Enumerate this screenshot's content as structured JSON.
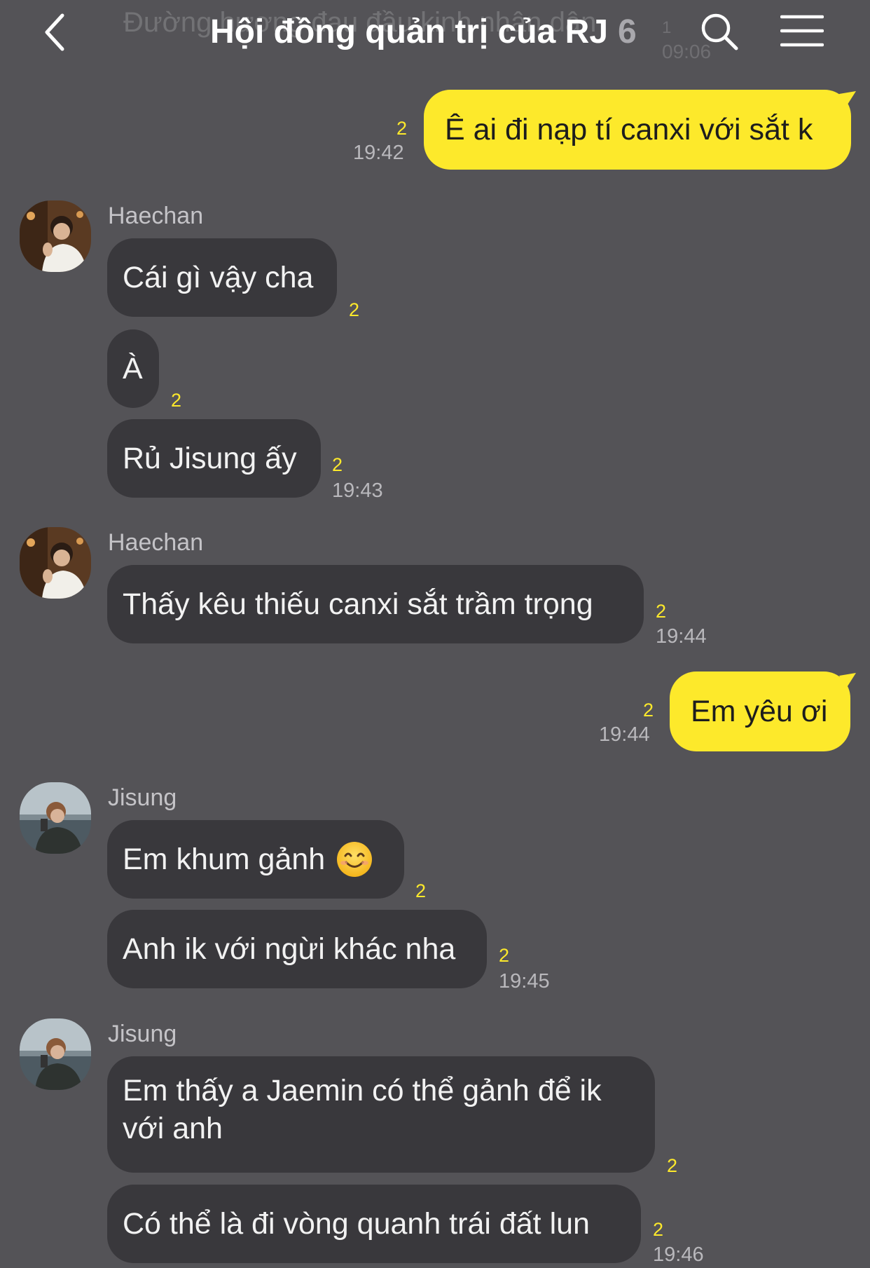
{
  "header": {
    "title": "Hội đồng quản trị của RJ",
    "member_count": "6",
    "ghost_preview": "Đường hương đau đầu kinh nhân dân",
    "ghost_time": "09:06",
    "ghost_count": "1"
  },
  "messages": [
    {
      "side": "mine",
      "text": "Ê ai đi nạp tí canxi với sắt k",
      "unread": "2",
      "time": "19:42"
    },
    {
      "side": "other",
      "sender": "Haechan",
      "text": "Cái gì vậy cha",
      "unread": "2",
      "time": ""
    },
    {
      "side": "other",
      "text": "À",
      "unread": "2",
      "time": ""
    },
    {
      "side": "other",
      "text": "Rủ Jisung ấy",
      "unread": "2",
      "time": "19:43"
    },
    {
      "side": "other",
      "sender": "Haechan",
      "text": "Thấy kêu thiếu canxi sắt trầm trọng",
      "unread": "2",
      "time": "19:44"
    },
    {
      "side": "mine",
      "text": "Em yêu ơi",
      "unread": "2",
      "time": "19:44"
    },
    {
      "side": "other",
      "sender": "Jisung",
      "text": "Em khum gảnh",
      "emoji": "smiling-face-emoji",
      "unread": "2",
      "time": ""
    },
    {
      "side": "other",
      "text": "Anh ik với ngừi khác nha",
      "unread": "2",
      "time": "19:45"
    },
    {
      "side": "other",
      "sender": "Jisung",
      "text": "Em thấy a Jaemin có thể gảnh để ik với anh",
      "unread": "2",
      "time": ""
    },
    {
      "side": "other",
      "text": "Có thể là đi vòng quanh trái đất lun",
      "unread": "2",
      "time": "19:46"
    }
  ],
  "icons": {
    "back": "chevron-left-icon",
    "search": "search-icon",
    "menu": "hamburger-menu-icon"
  },
  "colors": {
    "background": "#545357",
    "bubble_other": "#39383c",
    "bubble_mine": "#fde92b",
    "unread": "#fde92b"
  }
}
